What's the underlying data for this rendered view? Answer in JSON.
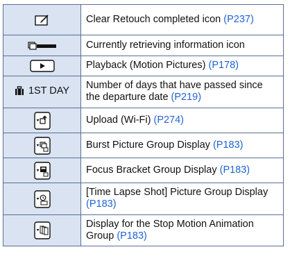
{
  "rows": [
    {
      "icon": "retouch-completed-icon",
      "desc": "Clear Retouch completed icon ",
      "ref": "(P237)"
    },
    {
      "icon": "retrieving-info-icon",
      "desc": "Currently retrieving information icon",
      "ref": ""
    },
    {
      "icon": "playback-icon",
      "desc": "Playback (Motion Pictures) ",
      "ref": "(P178)"
    },
    {
      "icon": "suitcase-icon",
      "icon_text": "1ST DAY",
      "desc": "Number of days that have passed since the departure date ",
      "ref": "(P219)"
    },
    {
      "icon": "upload-icon",
      "desc": "Upload (Wi-Fi) ",
      "ref": "(P274)"
    },
    {
      "icon": "burst-group-icon",
      "desc": "Burst Picture Group Display ",
      "ref": "(P183)"
    },
    {
      "icon": "focus-bracket-group-icon",
      "desc": "Focus Bracket Group Display ",
      "ref": "(P183)"
    },
    {
      "icon": "time-lapse-group-icon",
      "desc": "[Time Lapse Shot] Picture Group Display ",
      "ref": "(P183)"
    },
    {
      "icon": "stop-motion-group-icon",
      "desc": "Display for the Stop Motion Animation Group ",
      "ref": "(P183)"
    }
  ],
  "colors": {
    "icon_bg": "#d9e3f2",
    "border": "#5a6f93",
    "link": "#1f63d3"
  }
}
